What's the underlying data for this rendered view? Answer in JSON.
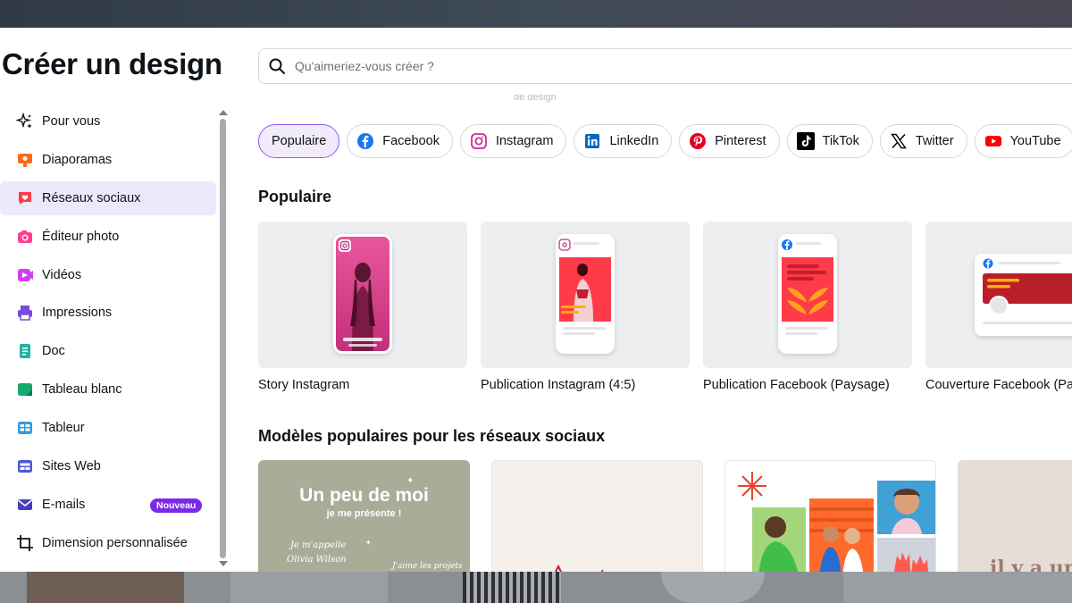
{
  "title": "Créer un design",
  "search": {
    "placeholder": "Qu'aimeriez-vous créer ?"
  },
  "search_fade_text": "de design",
  "sidebar": {
    "items": [
      {
        "label": "Pour vous",
        "icon": "sparkle-icon",
        "color": "#0e1318"
      },
      {
        "label": "Diaporamas",
        "icon": "presentation-icon",
        "color": "#ff6a13"
      },
      {
        "label": "Réseaux sociaux",
        "icon": "heart-chat-icon",
        "color": "#ff3b4a",
        "active": true
      },
      {
        "label": "Éditeur photo",
        "icon": "camera-icon",
        "color": "#ff3f8e"
      },
      {
        "label": "Vidéos",
        "icon": "video-play-icon",
        "color": "#d23eeb"
      },
      {
        "label": "Impressions",
        "icon": "printer-icon",
        "color": "#7a4bd9"
      },
      {
        "label": "Doc",
        "icon": "document-icon",
        "color": "#1fb3a3"
      },
      {
        "label": "Tableau blanc",
        "icon": "whiteboard-icon",
        "color": "#17a86b"
      },
      {
        "label": "Tableur",
        "icon": "spreadsheet-icon",
        "color": "#2e9cdb"
      },
      {
        "label": "Sites Web",
        "icon": "website-icon",
        "color": "#4a5bd6"
      },
      {
        "label": "E-mails",
        "icon": "envelope-icon",
        "color": "#4b3bc2",
        "badge": "Nouveau"
      },
      {
        "label": "Dimension personnalisée",
        "icon": "crop-icon",
        "color": "#0e1318"
      }
    ]
  },
  "chips": [
    {
      "label": "Populaire",
      "icon": "",
      "active": true
    },
    {
      "label": "Facebook",
      "icon": "facebook-icon",
      "color": "#1877f2"
    },
    {
      "label": "Instagram",
      "icon": "instagram-icon",
      "color": "#d6249f"
    },
    {
      "label": "LinkedIn",
      "icon": "linkedin-icon",
      "color": "#0a66c2"
    },
    {
      "label": "Pinterest",
      "icon": "pinterest-icon",
      "color": "#e60023"
    },
    {
      "label": "TikTok",
      "icon": "tiktok-icon",
      "color": "#000000"
    },
    {
      "label": "Twitter",
      "icon": "x-twitter-icon",
      "color": "#000000"
    },
    {
      "label": "YouTube",
      "icon": "youtube-icon",
      "color": "#ff0000"
    }
  ],
  "populaire": {
    "title": "Populaire",
    "cards": [
      {
        "label": "Story Instagram"
      },
      {
        "label": "Publication Instagram (4:5)"
      },
      {
        "label": "Publication Facebook (Paysage)"
      },
      {
        "label": "Couverture Facebook (Paysage)"
      }
    ]
  },
  "modeles": {
    "title": "Modèles populaires pour les réseaux sociaux",
    "tpl1": {
      "headline": "Un peu de moi",
      "sub": "je me présente !",
      "script1": "Je m'appelle",
      "script2": "Olivia Wilson",
      "script3": "J'aime les projets"
    },
    "tpl4": {
      "text": "il y a un"
    }
  },
  "colors": {
    "accent": "#7d2ae8",
    "active_bg": "#ede8fb"
  }
}
